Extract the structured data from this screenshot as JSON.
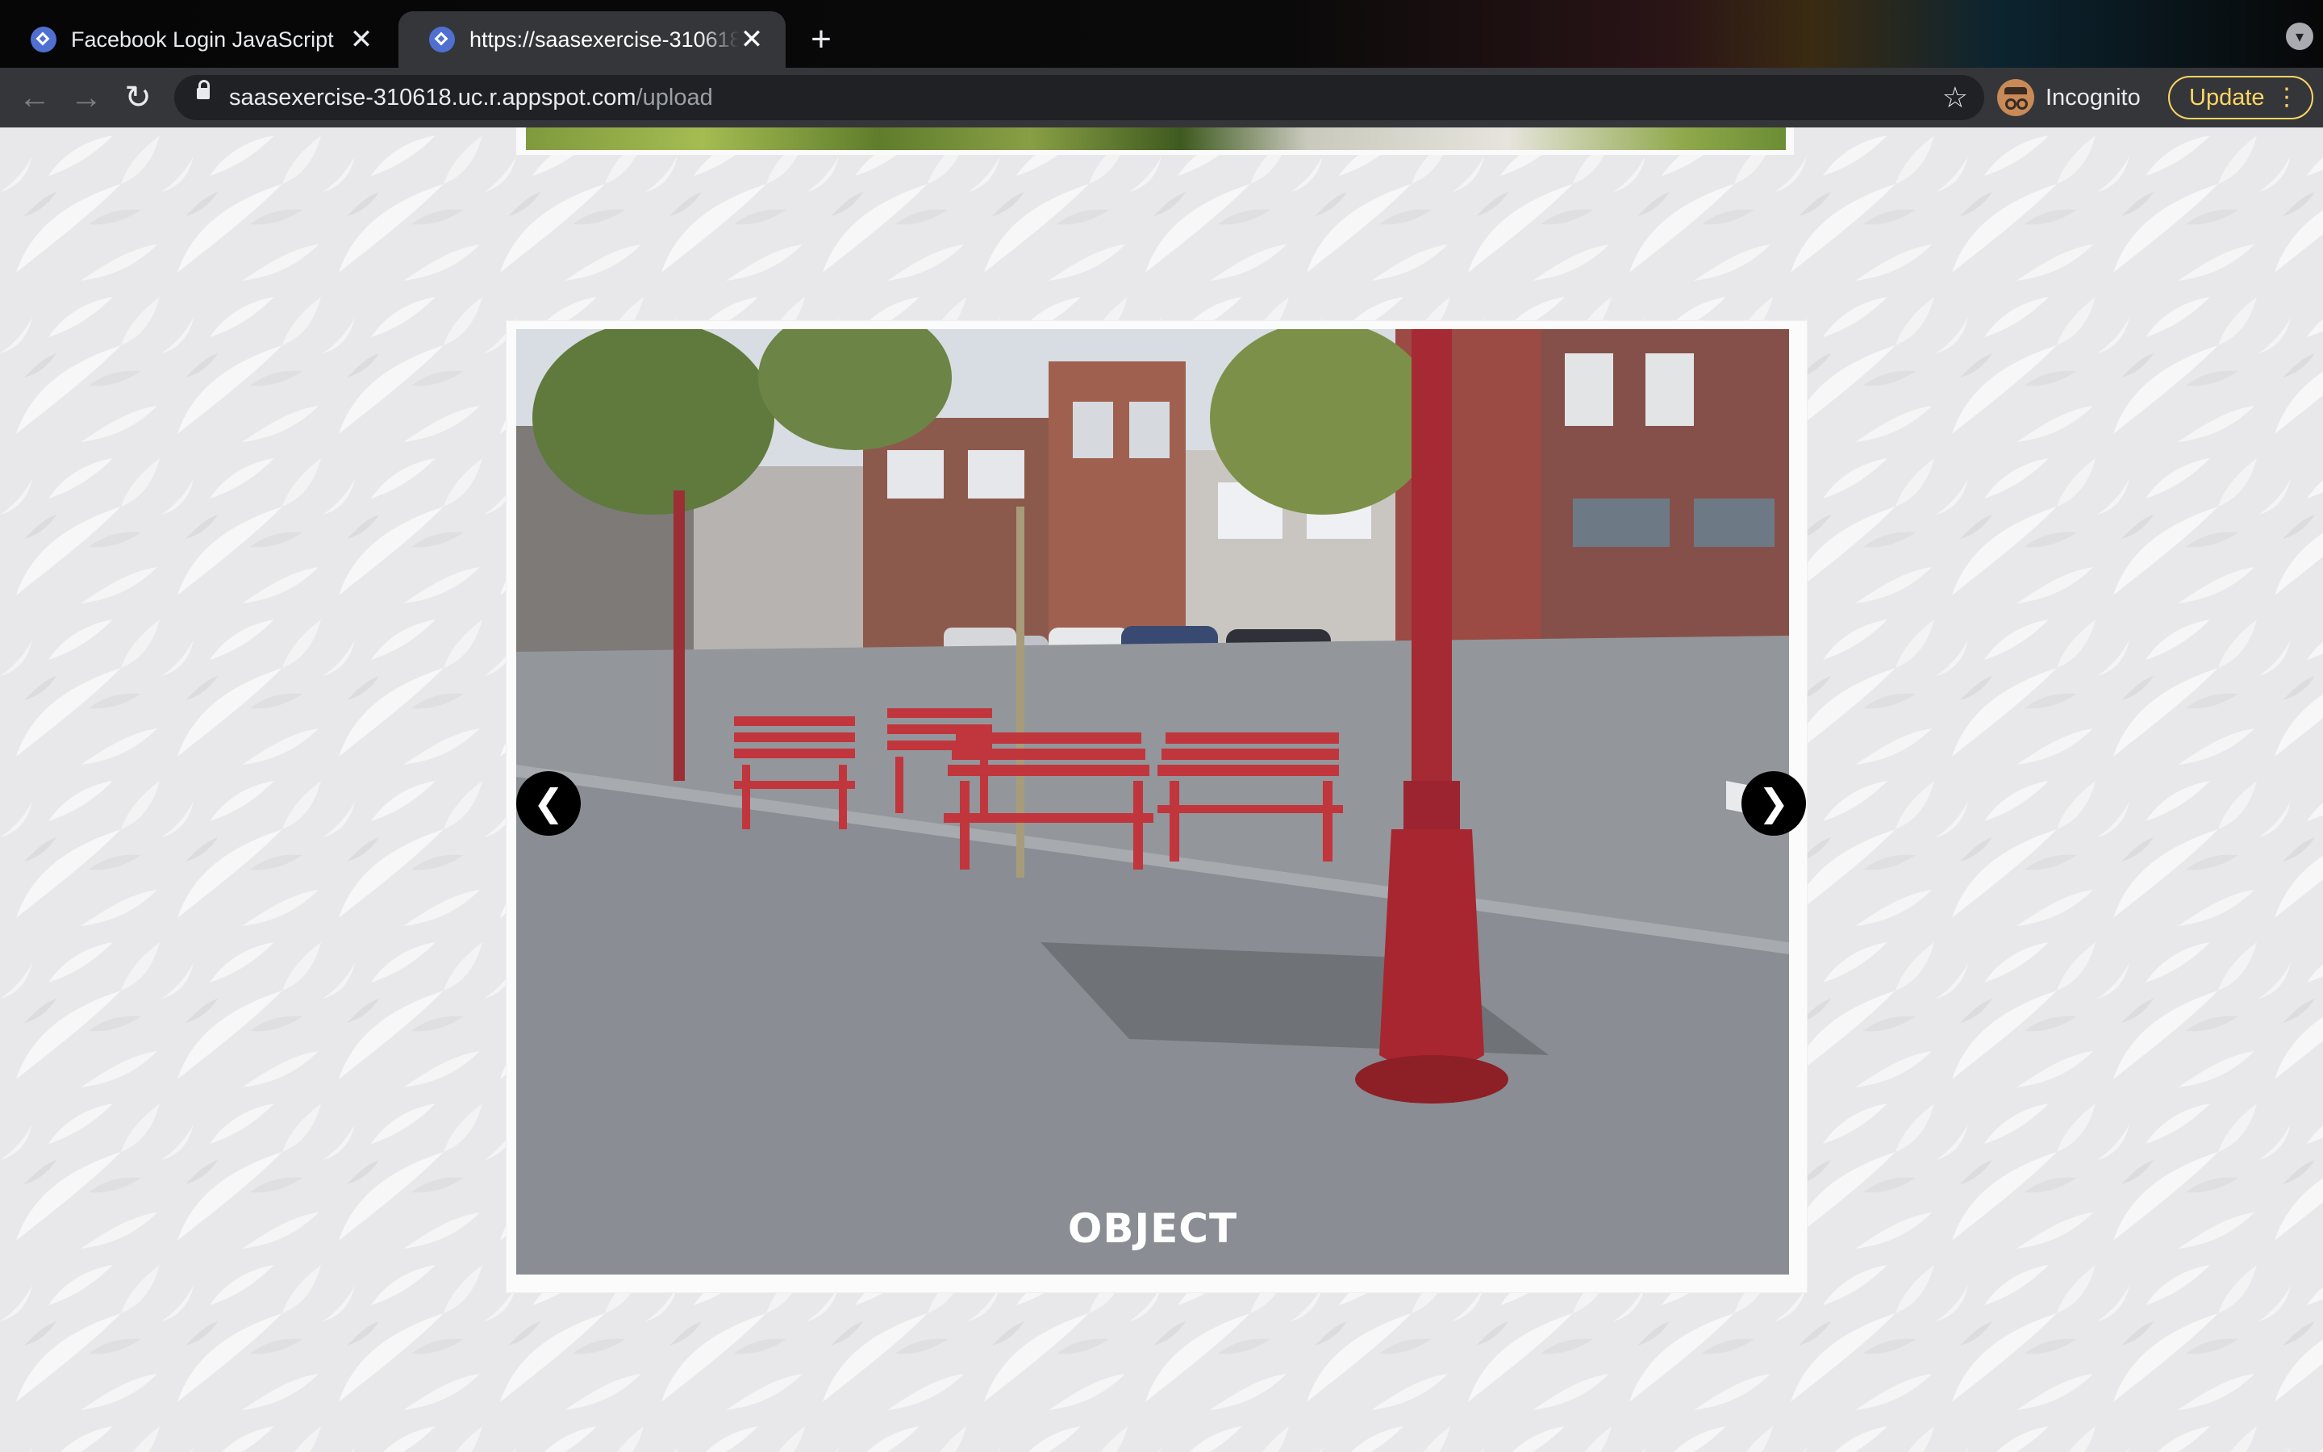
{
  "tabs": [
    {
      "title": "Facebook Login JavaScript",
      "close": "✕",
      "active": false
    },
    {
      "title": "https://saasexercise-310618.uc.r.appspot.com/upload",
      "close": "✕",
      "active": true
    }
  ],
  "new_tab": "+",
  "tab_menu": "▾",
  "nav": {
    "back": "←",
    "forward": "→",
    "reload": "↻"
  },
  "address": {
    "domain": "saasexercise-310618.uc.r.appspot.com",
    "path": "/upload",
    "star": "☆"
  },
  "profile": {
    "label": "Incognito"
  },
  "update": {
    "label": "Update",
    "menu": "⋮"
  },
  "slideshow": {
    "caption": "OBJECT",
    "prev_label": "❮",
    "next_label": "❯"
  },
  "colors": {
    "chrome_dark": "#202124",
    "toolbar": "#35363a",
    "update_accent": "#fdd663",
    "bench_red": "#c1363d"
  }
}
